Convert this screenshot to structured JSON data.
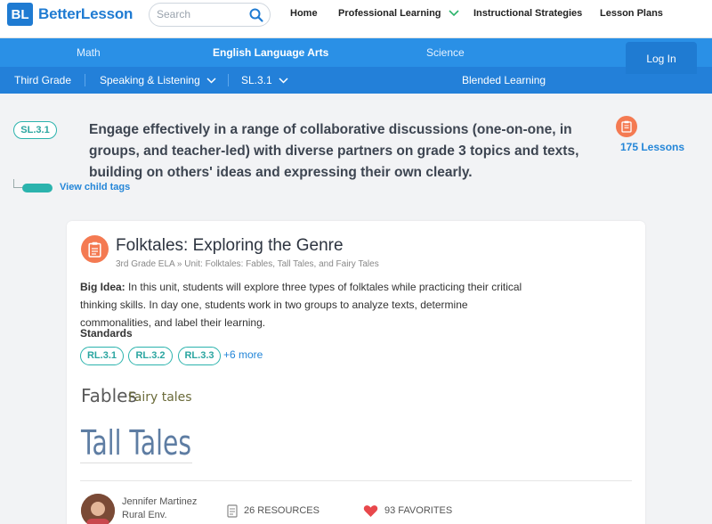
{
  "header": {
    "logo_mark": "BL",
    "logo_text": "BetterLesson",
    "search_placeholder": "Search",
    "nav": [
      "Home",
      "Professional Learning",
      "Instructional Strategies",
      "Lesson Plans"
    ]
  },
  "subjects": {
    "items": [
      "Math",
      "English Language Arts",
      "Science"
    ],
    "active": "English Language Arts",
    "login_label": "Log In"
  },
  "crumbs": {
    "grade": "Third Grade",
    "strand": "Speaking & Listening",
    "standard": "SL.3.1",
    "blended": "Blended Learning"
  },
  "standard": {
    "code": "SL.3.1",
    "description": "Engage effectively in a range of collaborative discussions (one-on-one, in groups, and teacher-led) with diverse partners on grade 3 topics and texts, building on others' ideas and expressing their own clearly.",
    "lessons_count": "175 Lessons",
    "child_tags_label": "View child tags"
  },
  "lesson": {
    "title": "Folktales: Exploring the Genre",
    "subtitle": "3rd Grade ELA » Unit: Folktales: Fables, Tall Tales, and Fairy Tales",
    "big_idea_label": "Big Idea:",
    "big_idea": "In this unit, students will explore three types of folktales while practicing their critical thinking skills. In day one, students work in two groups to analyze texts, determine commonalities, and label their learning.",
    "standards_label": "Standards",
    "tags": [
      "RL.3.1",
      "RL.3.2",
      "RL.3.3"
    ],
    "more_tags": "+6 more",
    "thumb_words": [
      "Fables",
      "Fairy tales",
      "Tall Tales"
    ],
    "author_name": "Jennifer Martinez",
    "author_location": "Rural Env.",
    "resources": "26 RESOURCES",
    "favorites": "93 FAVORITES"
  },
  "colors": {
    "brand_blue": "#1f7bd2",
    "subject_bar": "#2a90e6",
    "teal": "#2bb3ad",
    "orange": "#f47a52",
    "heart": "#e8484c"
  }
}
